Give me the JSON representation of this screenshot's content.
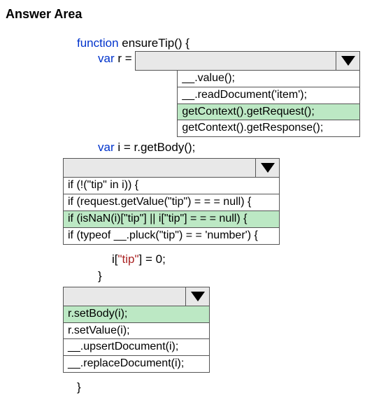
{
  "title": "Answer Area",
  "code": {
    "func_kw": "function",
    "func_name": " ensureTip() {",
    "var_kw": "var",
    "r_decl": " r = ",
    "i_decl": " i = r.getBody();",
    "tip_assign_pre": "i[",
    "tip_key": "\"tip\"",
    "tip_assign_post": "] = 0;",
    "brace": "}",
    "outer_brace": "}"
  },
  "dropdown1": {
    "options": {
      "o1": "__.value();",
      "o2": "__.readDocument('item');",
      "o3": "getContext().getRequest();",
      "o4": "getContext().getResponse();"
    }
  },
  "dropdown2": {
    "options": {
      "o1": "if (!(\"tip\" in i)) {",
      "o2": "if (request.getValue(\"tip\") = = = null) {",
      "o3": "if (isNaN(i)[\"tip\"] || i[\"tip\"] = = = null) {",
      "o4": "if (typeof __.pluck(\"tip\") = = 'number') {"
    }
  },
  "dropdown3": {
    "options": {
      "o1": "r.setBody(i);",
      "o2": "r.setValue(i);",
      "o3": "__.upsertDocument(i);",
      "o4": "__.replaceDocument(i);"
    }
  }
}
